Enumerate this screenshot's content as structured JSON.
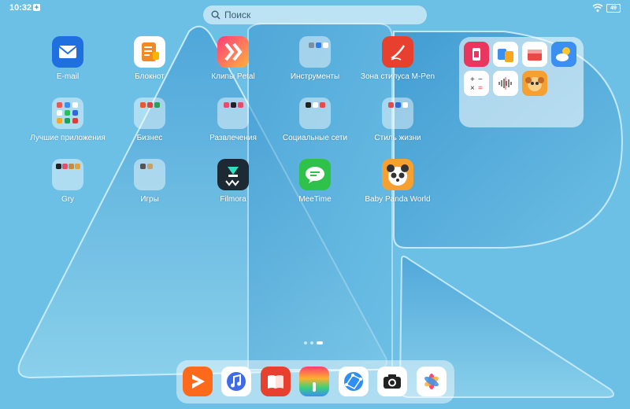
{
  "status_bar": {
    "time": "10:32",
    "battery": "49"
  },
  "search": {
    "placeholder": "Поиск"
  },
  "apps": [
    {
      "label": "E-mail",
      "icon": "mail-icon"
    },
    {
      "label": "Блокнот",
      "icon": "notepad-icon"
    },
    {
      "label": "Клипы Petal",
      "icon": "petal-clips-icon"
    },
    {
      "label": "Инструменты",
      "icon": "tools-folder-icon"
    },
    {
      "label": "Зона стилуса M-Pen",
      "icon": "m-pen-icon"
    },
    {
      "label": "Лучшие приложения",
      "icon": "best-apps-folder-icon"
    },
    {
      "label": "Бизнес",
      "icon": "business-folder-icon"
    },
    {
      "label": "Развлечения",
      "icon": "entertainment-folder-icon"
    },
    {
      "label": "Социальные сети",
      "icon": "social-folder-icon"
    },
    {
      "label": "Стиль жизни",
      "icon": "lifestyle-folder-icon"
    },
    {
      "label": "Gry",
      "icon": "gry-folder-icon"
    },
    {
      "label": "Игры",
      "icon": "games-folder-icon"
    },
    {
      "label": "Filmora",
      "icon": "filmora-icon"
    },
    {
      "label": "MeeTime",
      "icon": "meetime-icon"
    },
    {
      "label": "Baby Panda World",
      "icon": "baby-panda-icon"
    }
  ],
  "large_folder": {
    "apps": [
      "app-gallery-icon",
      "phone-clone-icon",
      "tips-icon",
      "weather-icon",
      "calculator-icon",
      "sound-recorder-icon",
      "kids-icon"
    ]
  },
  "page_indicator": {
    "pages": 3,
    "current": 3
  },
  "dock": [
    "video-player-icon",
    "music-icon",
    "books-icon",
    "themes-icon",
    "browser-icon",
    "camera-icon",
    "gallery-icon"
  ],
  "colors": {
    "wallpaper": "#5eb6e0",
    "mail": "#1f6fe0",
    "notepad": "#f08a24",
    "m_pen": "#e8402f",
    "meetime": "#2fc24a"
  }
}
